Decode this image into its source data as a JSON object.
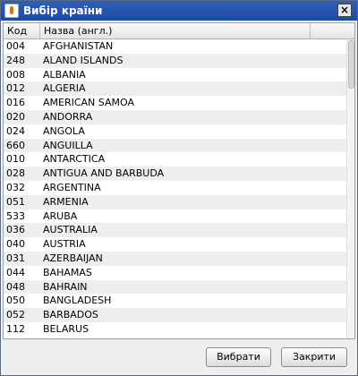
{
  "window": {
    "title": "Вибір країни",
    "close_glyph": "×"
  },
  "table": {
    "headers": {
      "code": "Код",
      "name": "Назва (англ.)",
      "extra": ""
    },
    "rows": [
      {
        "code": "004",
        "name": "AFGHANISTAN"
      },
      {
        "code": "248",
        "name": "ALAND ISLANDS"
      },
      {
        "code": "008",
        "name": "ALBANIA"
      },
      {
        "code": "012",
        "name": "ALGERIA"
      },
      {
        "code": "016",
        "name": "AMERICAN SAMOA"
      },
      {
        "code": "020",
        "name": "ANDORRA"
      },
      {
        "code": "024",
        "name": "ANGOLA"
      },
      {
        "code": "660",
        "name": "ANGUILLA"
      },
      {
        "code": "010",
        "name": "ANTARCTICA"
      },
      {
        "code": "028",
        "name": "ANTIGUA AND BARBUDA"
      },
      {
        "code": "032",
        "name": "ARGENTINA"
      },
      {
        "code": "051",
        "name": "ARMENIA"
      },
      {
        "code": "533",
        "name": "ARUBA"
      },
      {
        "code": "036",
        "name": "AUSTRALIA"
      },
      {
        "code": "040",
        "name": "AUSTRIA"
      },
      {
        "code": "031",
        "name": "AZERBAIJAN"
      },
      {
        "code": "044",
        "name": "BAHAMAS"
      },
      {
        "code": "048",
        "name": "BAHRAIN"
      },
      {
        "code": "050",
        "name": "BANGLADESH"
      },
      {
        "code": "052",
        "name": "BARBADOS"
      },
      {
        "code": "112",
        "name": "BELARUS"
      }
    ]
  },
  "buttons": {
    "select": "Вибрати",
    "close": "Закрити"
  }
}
